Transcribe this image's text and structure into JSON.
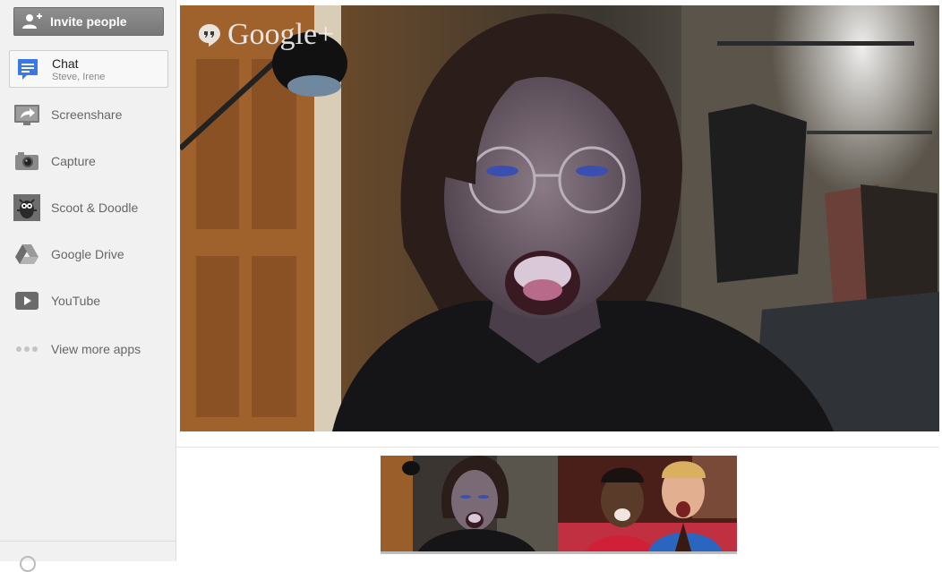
{
  "sidebar": {
    "invite_label": "Invite people",
    "items": [
      {
        "id": "chat",
        "label": "Chat",
        "sub": "Steve, Irene",
        "icon": "chat-icon"
      },
      {
        "id": "screenshare",
        "label": "Screenshare",
        "icon": "screenshare-icon"
      },
      {
        "id": "capture",
        "label": "Capture",
        "icon": "camera-icon"
      },
      {
        "id": "scoot-doodle",
        "label": "Scoot & Doodle",
        "icon": "doodle-monster-icon"
      },
      {
        "id": "google-drive",
        "label": "Google Drive",
        "icon": "drive-icon"
      },
      {
        "id": "youtube",
        "label": "YouTube",
        "icon": "youtube-play-icon"
      },
      {
        "id": "more-apps",
        "label": "View more apps",
        "icon": "more-dots-icon"
      }
    ]
  },
  "main": {
    "logo_text": "Google+"
  },
  "thumbnails": [
    {
      "name": "participant-thumbnail-1"
    },
    {
      "name": "participant-thumbnail-2"
    }
  ],
  "colors": {
    "chat_blue": "#3b78e7",
    "sidebar_bg": "#f1f1f1",
    "invite_bg": "#838383"
  }
}
